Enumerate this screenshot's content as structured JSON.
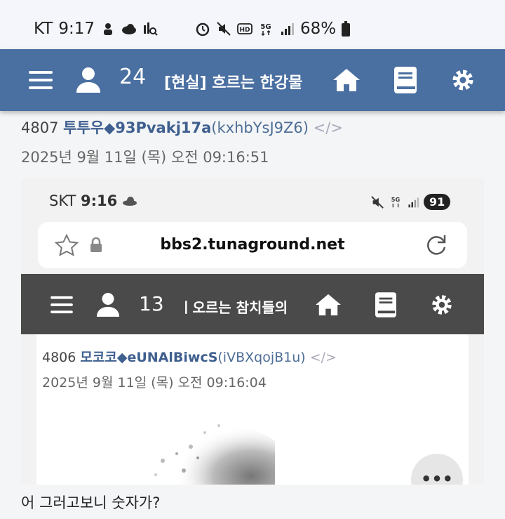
{
  "status_bar": {
    "carrier": "KT",
    "time": "9:17",
    "battery": "68%",
    "icons": [
      "game-icon",
      "cloud-icon",
      "search-chart-icon",
      "alarm-icon",
      "mute-icon",
      "hd-icon",
      "5g-icon",
      "signal-icon",
      "battery-icon"
    ]
  },
  "nav": {
    "count": "24",
    "thread_title": "[현실] 흐르는 한강물",
    "icons": [
      "menu-icon",
      "user-icon",
      "home-icon",
      "book-icon",
      "gear-icon"
    ]
  },
  "post": {
    "number": "4807",
    "name": "투투우◆93Pvakj17a",
    "id": "(kxhbYsJ9Z6)",
    "code_icon": "</>",
    "date": "2025년 9월 11일 (목) 오전 09:16:51",
    "body": "어 그러고보니 숫자가?"
  },
  "embedded": {
    "carrier": "SKT",
    "time": "9:16",
    "battery": "91",
    "url": "bbs2.tunaground.net",
    "nav": {
      "count": "13",
      "thread_title": "ㅣ오르는 참치들의"
    },
    "post": {
      "number": "4806",
      "name": "모코코◆eUNAlBiwcS",
      "id": "(iVBXqojB1u)",
      "code_icon": "</>",
      "date": "2025년 9월 11일 (목) 오전 09:16:04"
    },
    "fab_label": "•••"
  },
  "colors": {
    "nav_bg": "#4a6fa1",
    "inner_nav_bg": "#4a4a4a",
    "name_color": "#3f5f8f"
  }
}
